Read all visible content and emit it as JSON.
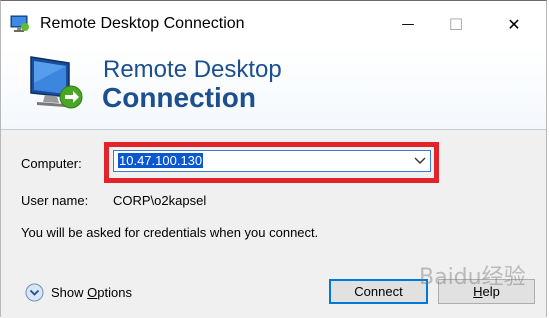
{
  "window": {
    "title": "Remote Desktop Connection",
    "minimize_glyph": "—",
    "maximize_glyph": "☐",
    "close_glyph": "✕"
  },
  "banner": {
    "line1": "Remote Desktop",
    "line2": "Connection",
    "icon": "remote-desktop-monitor-icon"
  },
  "form": {
    "computer_label": "Computer:",
    "computer_value": "10.47.100.130",
    "username_label": "User name:",
    "username_value": "CORP\\o2kapsel",
    "info_text": "You will be asked for credentials when you connect."
  },
  "footer": {
    "show_options_prefix": "Show ",
    "show_options_underlined": "O",
    "show_options_suffix": "ptions",
    "connect_label": "Connect",
    "help_prefix": "",
    "help_underlined": "H",
    "help_suffix": "elp"
  },
  "colors": {
    "highlight": "#e1232b",
    "banner_text": "#1c4f8f",
    "selection": "#0a58d0"
  },
  "watermark": "Baidu经验"
}
